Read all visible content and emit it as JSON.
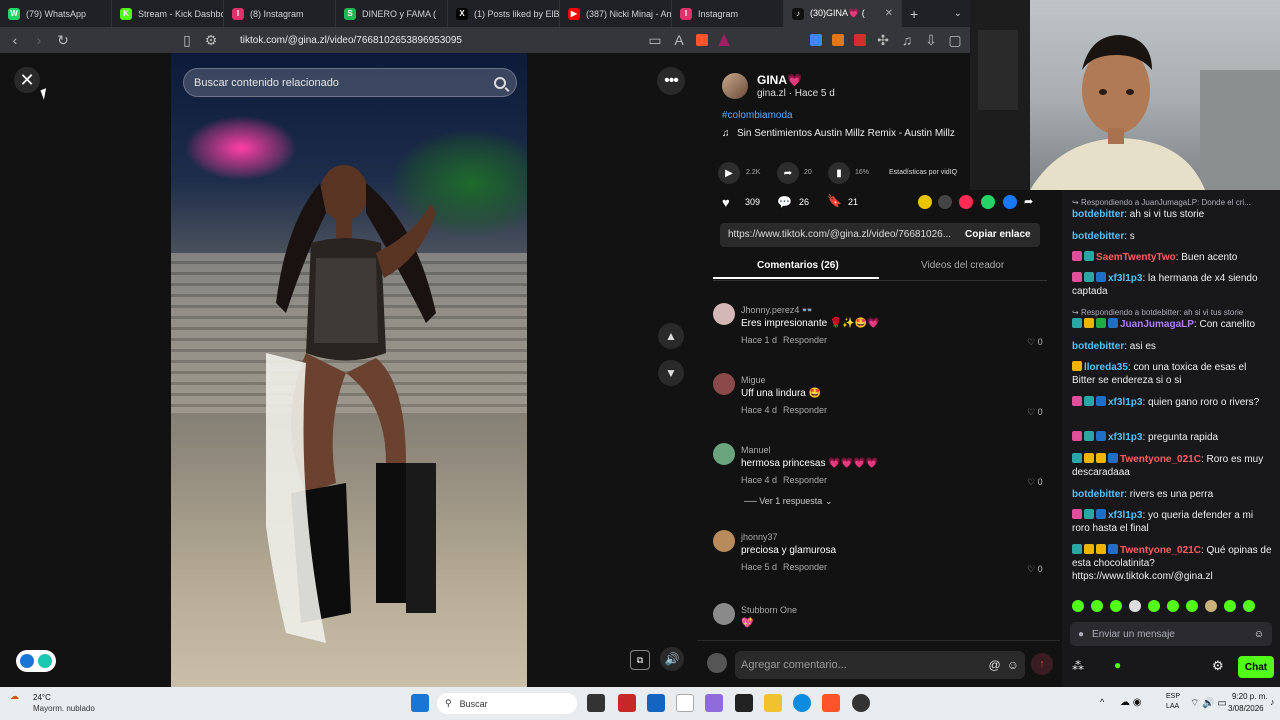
{
  "browser": {
    "tabs": [
      {
        "title": "(79) WhatsApp",
        "color": "#25D366",
        "glyph": "W"
      },
      {
        "title": "Stream - Kick Dashbo",
        "color": "#53FC18",
        "glyph": "K"
      },
      {
        "title": "(8) Instagram",
        "color": "#E1306C",
        "glyph": "I"
      },
      {
        "title": "DINERO y FAMA (",
        "color": "#1DB954",
        "glyph": "S"
      },
      {
        "title": "(1) Posts liked by ElBit",
        "color": "#000000",
        "glyph": "X"
      },
      {
        "title": "(387) Nicki Minaj - An",
        "color": "#FF0000",
        "glyph": "▶"
      },
      {
        "title": "Instagram",
        "color": "#E1306C",
        "glyph": "I"
      },
      {
        "title": "(30)GINA💗 (",
        "color": "#111111",
        "glyph": "♪"
      }
    ],
    "new_tab": "+",
    "url": "tiktok.com/@gina.zl/video/7668102653896953095"
  },
  "video": {
    "search_placeholder": "Buscar contenido relacionado"
  },
  "post": {
    "author_name": "GINA💗",
    "author_meta": "gina.zl · Hace 5 d",
    "hashtag": "#colombiamoda",
    "music": "Sin Sentimientos Austin Millz Remix - Austin Millz",
    "stats": {
      "plays": "2.2K",
      "shares": "20",
      "percent": "16%",
      "analytics_label": "Estadísticas por vidIQ"
    },
    "likes": "309",
    "comments": "26",
    "saves": "21",
    "link": "https://www.tiktok.com/@gina.zl/video/76681026...",
    "copy_label": "Copiar enlace",
    "tab_comments": "Comentarios (26)",
    "tab_videos": "Videos del creador",
    "comment_placeholder": "Agregar comentario..."
  },
  "comments": [
    {
      "user": "Jhonny.perez4 👓",
      "text": "Eres impresionante 🌹✨🤩💗",
      "time": "Hace 1 d",
      "reply": "Responder",
      "likes": "0",
      "avatar": "#d4b8b8"
    },
    {
      "user": "Migue",
      "text": "Uff una lindura 🤩",
      "time": "Hace 4 d",
      "reply": "Responder",
      "likes": "0",
      "avatar": "#8b4a4a"
    },
    {
      "user": "Manuel",
      "text": "hermosa princesas 💗💗💗💗",
      "time": "Hace 4 d",
      "reply": "Responder",
      "likes": "0",
      "avatar": "#6aa57e"
    },
    {
      "user": "jhonny37",
      "text": "preciosa y glamurosa",
      "time": "Hace 5 d",
      "reply": "Responder",
      "likes": "0",
      "avatar": "#b88b5a"
    },
    {
      "user": "Stubborn One",
      "text": "💖",
      "time": "",
      "reply": "",
      "likes": "",
      "avatar": "#8a8a8a"
    }
  ],
  "view_replies": "Ver 1 respuesta",
  "chat": {
    "messages": [
      {
        "user": "",
        "text": "Respondiendo a JuanJumagaLP: Donde el cri...",
        "reply": true,
        "color": "#adadb8"
      },
      {
        "user": "botdebitter",
        "text": ": ah si vi tus storie",
        "color": "#53c1f7"
      },
      {
        "user": "botdebitter",
        "text": ": s",
        "color": "#53c1f7"
      },
      {
        "user": "SaemTwentyTwo",
        "text": ": Buen acento",
        "color": "#ff5f5f"
      },
      {
        "user": "xf3l1p3",
        "text": ": la hermana de x4 siendo captada",
        "color": "#53c1f7"
      },
      {
        "user": "",
        "text": "Respondiendo a botdebitter: ah si vi tus storie",
        "reply": true,
        "color": "#adadb8"
      },
      {
        "user": "JuanJumagaLP",
        "text": ": Con canelito",
        "color": "#b07cff"
      },
      {
        "user": "botdebitter",
        "text": ": asi es",
        "color": "#53c1f7"
      },
      {
        "user": "lloreda35",
        "text": ": con una toxica de esas el Bitter se endereza si o si",
        "color": "#53c1f7"
      },
      {
        "user": "xf3l1p3",
        "text": ": quien gano roro o rivers?",
        "color": "#53c1f7"
      },
      {
        "user": "xf3l1p3",
        "text": ": pregunta rapida",
        "color": "#53c1f7"
      },
      {
        "user": "Twentyone_021C",
        "text": ": Roro es muy descaradaaa",
        "color": "#ff5f5f"
      },
      {
        "user": "botdebitter",
        "text": ": rivers es una perra",
        "color": "#53c1f7"
      },
      {
        "user": "xf3l1p3",
        "text": ": yo queria defender a mi roro hasta el final",
        "color": "#53c1f7"
      },
      {
        "user": "Twentyone_021C",
        "text": ": Qué opinas de esta chocolatinita? https://www.tiktok.com/@gina.zl",
        "color": "#ff5f5f"
      }
    ],
    "input_placeholder": "Enviar un mensaje",
    "chat_button": "Chat"
  },
  "taskbar": {
    "weather_temp": "24°C",
    "weather_desc": "Mayorm. nublado",
    "search": "Buscar",
    "lang_top": "ESP",
    "lang_bottom": "LAA",
    "time": "9:20 p. m.",
    "date": "3/08/2026"
  }
}
